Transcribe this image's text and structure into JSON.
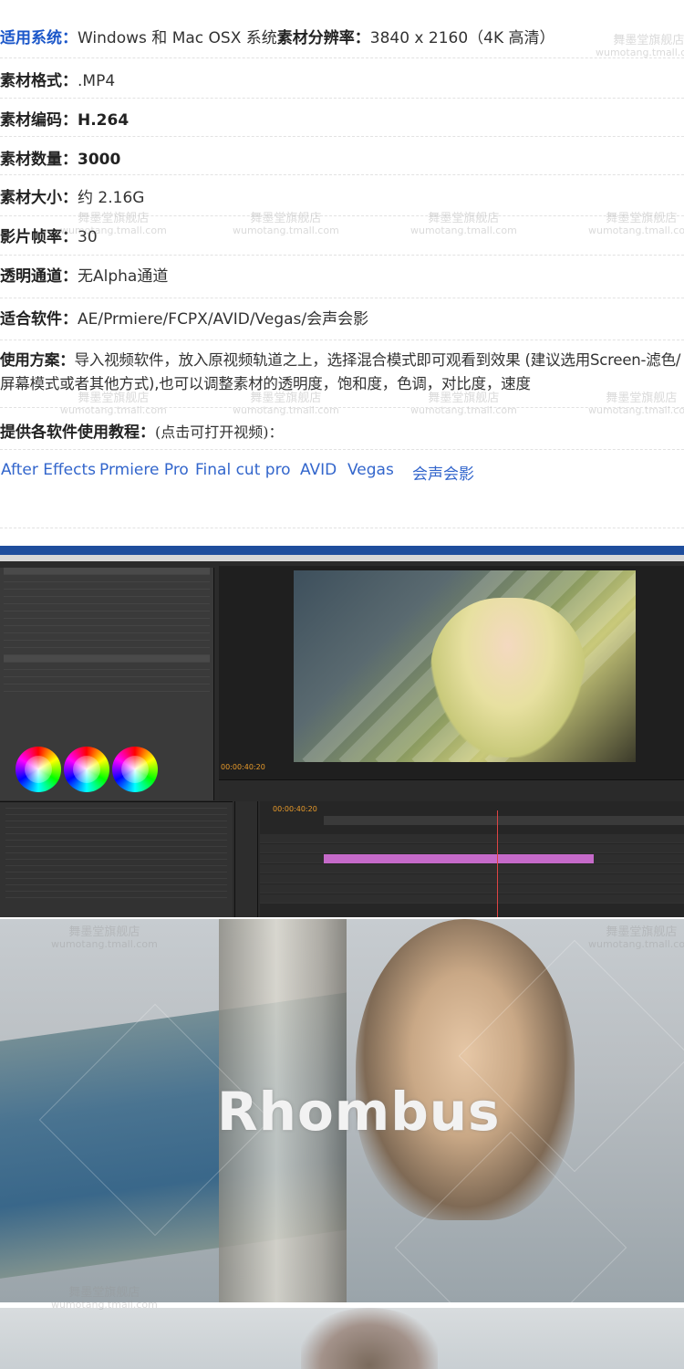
{
  "specs": {
    "system_label": "适用系统：",
    "system_value": "Windows 和 Mac OSX 系统",
    "resolution_label": "素材分辨率：",
    "resolution_value": "3840 x 2160（4K 高清）",
    "format_label": "素材格式：",
    "format_value": ".MP4",
    "codec_label": "素材编码：",
    "codec_value": "H.264",
    "count_label": "素材数量：",
    "count_value": "3000",
    "size_label": "素材大小：",
    "size_value": "约 2.16G",
    "fps_label": "影片帧率：",
    "fps_value": "30",
    "alpha_label": "透明通道：",
    "alpha_value": "无Alpha通道",
    "software_label": "适合软件：",
    "software_value": "AE/Prmiere/FCPX/AVID/Vegas/会声会影",
    "usage_label": "使用方案：",
    "usage_value": "导入视频软件，放入原视频轨道之上，选择混合模式即可观看到效果 (建议选用Screen-滤色/屏幕模式或者其他方式),也可以调整素材的透明度，饱和度，色调，对比度，速度",
    "tutorial_label": "提供各软件使用教程：",
    "tutorial_note": "(点击可打开视频)："
  },
  "tutorial_links": [
    "After Effects",
    "Prmiere Pro",
    "Final cut pro",
    "AVID",
    "Vegas",
    "会声会影"
  ],
  "watermark": {
    "line1": "舞墨堂旗舰店",
    "line2": "wumotang.tmall.com"
  },
  "premiere": {
    "timecode_monitor": "00:00:40:20",
    "timecode_timeline": "00:00:40:20"
  },
  "showcase": {
    "title": "Rhombus"
  },
  "colors": {
    "label_blue": "#1a56c9",
    "link_blue": "#3366cc",
    "clip_pink": "#c56ac9",
    "timecode_orange": "#e89a2a"
  }
}
